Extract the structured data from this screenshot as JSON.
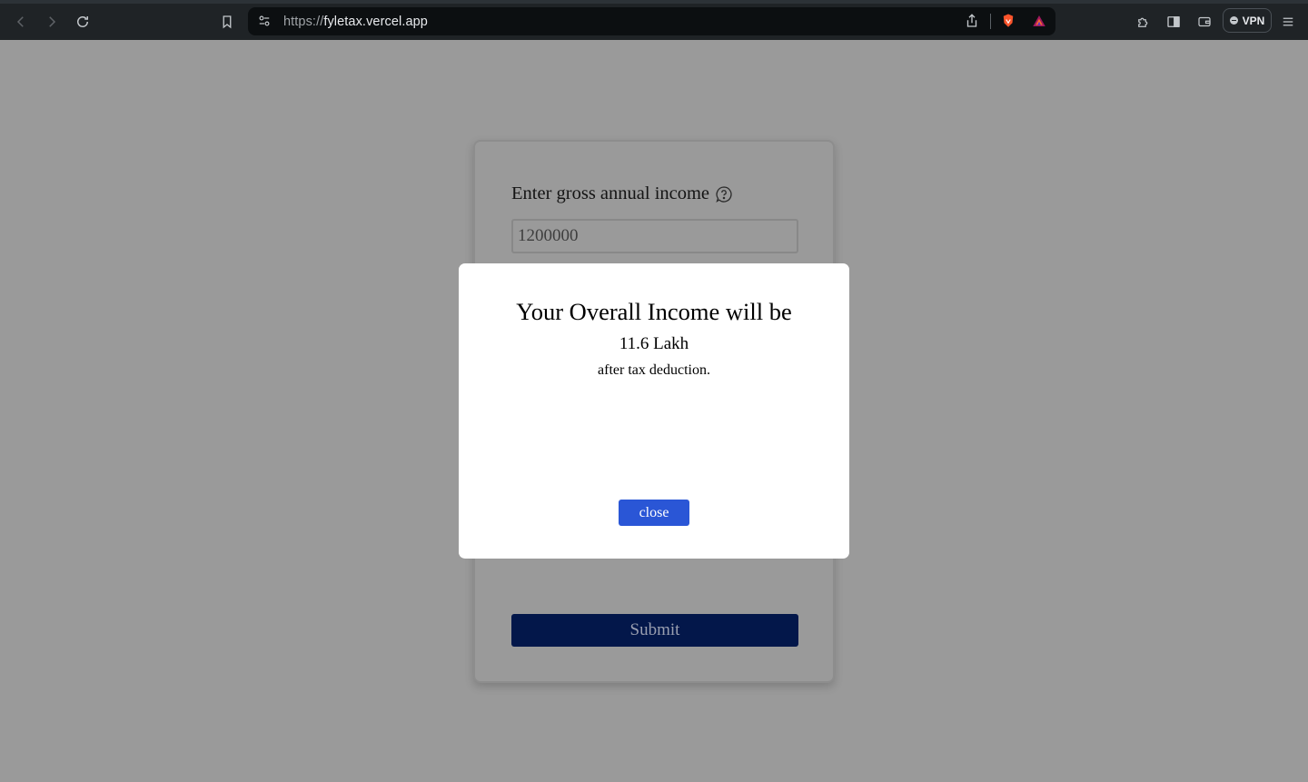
{
  "browser": {
    "url_scheme": "https://",
    "url_host": "fyletax.vercel.app",
    "vpn_label": "VPN"
  },
  "form": {
    "income_label": "Enter gross annual income",
    "income_value": "1200000",
    "submit_label": "Submit"
  },
  "modal": {
    "title": "Your Overall Income will be",
    "amount": "11.6 Lakh",
    "subtitle": "after tax deduction.",
    "close_label": "close"
  },
  "colors": {
    "modal_button": "#2a56d6",
    "submit_button": "#03174a",
    "backdrop": "#9a9a9a"
  }
}
